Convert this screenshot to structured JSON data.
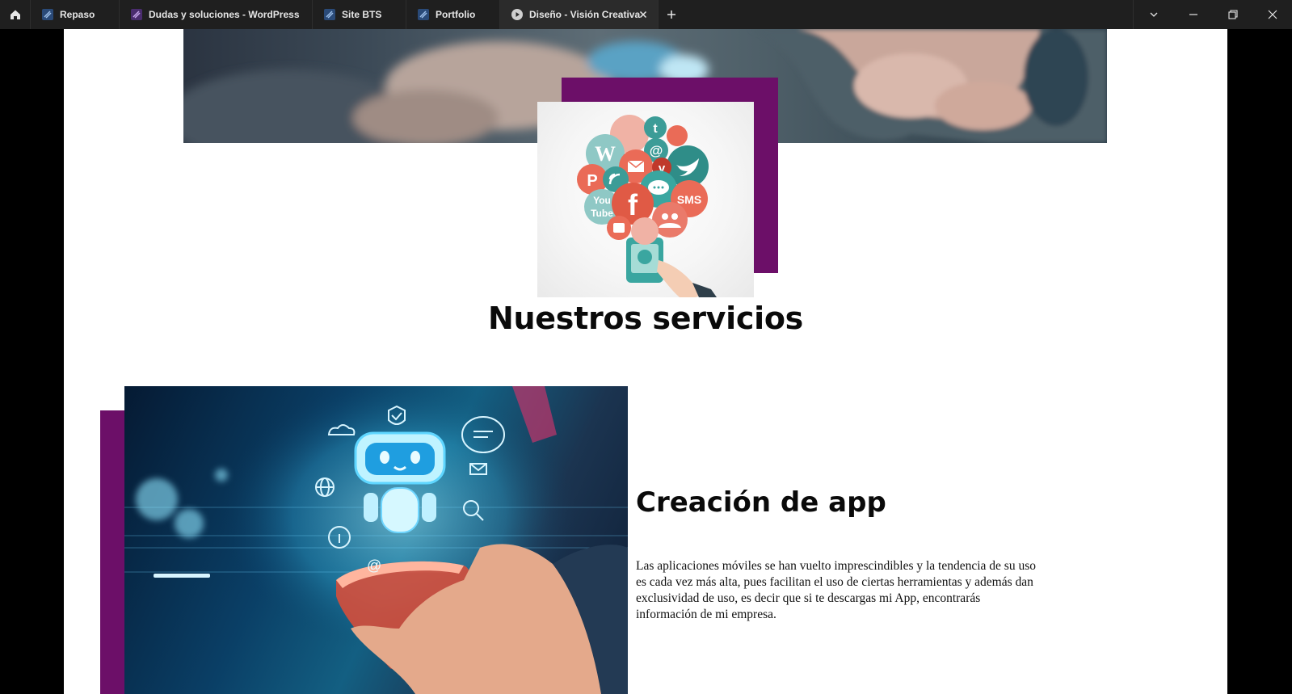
{
  "browser": {
    "tabs": [
      {
        "label": "Repaso",
        "icon": "site-favicon",
        "active": false
      },
      {
        "label": "Dudas y soluciones - WordPress",
        "icon": "wordpress-site-favicon",
        "active": false
      },
      {
        "label": "Site BTS",
        "icon": "site-favicon",
        "active": false
      },
      {
        "label": "Portfolio",
        "icon": "site-favicon",
        "active": false
      },
      {
        "label": "Diseño - Visión Creativa",
        "icon": "play-circle-icon",
        "active": true
      }
    ],
    "controls": [
      "tab-list-dropdown",
      "minimize",
      "restore",
      "close"
    ]
  },
  "page": {
    "accent_color": "#6c0f68",
    "section_heading": "Nuestros servicios",
    "service": {
      "title": "Creación de app",
      "description": "Las aplicaciones móviles se han vuelto imprescindibles y la tendencia de su uso es cada vez más alta, pues facilitan el uso de ciertas herramientas y además dan exclusividad de uso, es decir que si te descargas mi App, encontrarás información de mi empresa."
    },
    "social_bubbles": {
      "sms": "SMS",
      "you": "You",
      "tube": "Tube",
      "facebook": "f",
      "vimeo": "v",
      "at": "@",
      "twitter": "t"
    }
  }
}
